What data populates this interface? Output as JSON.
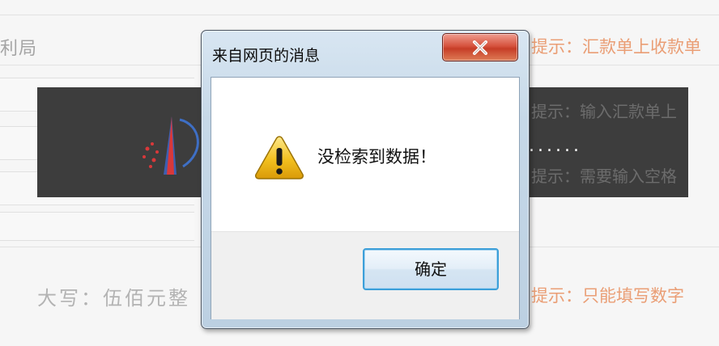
{
  "background": {
    "left_label": "利局",
    "amount_in_words": "大写：伍佰元整",
    "hints": [
      "提示：汇款单上收款单",
      "提示：输入汇款单上",
      "提示：需要输入空格",
      "提示：只能填写数字"
    ],
    "overlay_dots": "......"
  },
  "dialog": {
    "title": "来自网页的消息",
    "message": "没检索到数据！",
    "ok_label": "确定",
    "close_icon": "close-x-icon",
    "warning_icon": "warning-triangle-icon",
    "colors": {
      "close_button": "#d6533e",
      "ok_button_border": "#3c9fd9",
      "warning_yellow": "#f2c01f"
    }
  }
}
